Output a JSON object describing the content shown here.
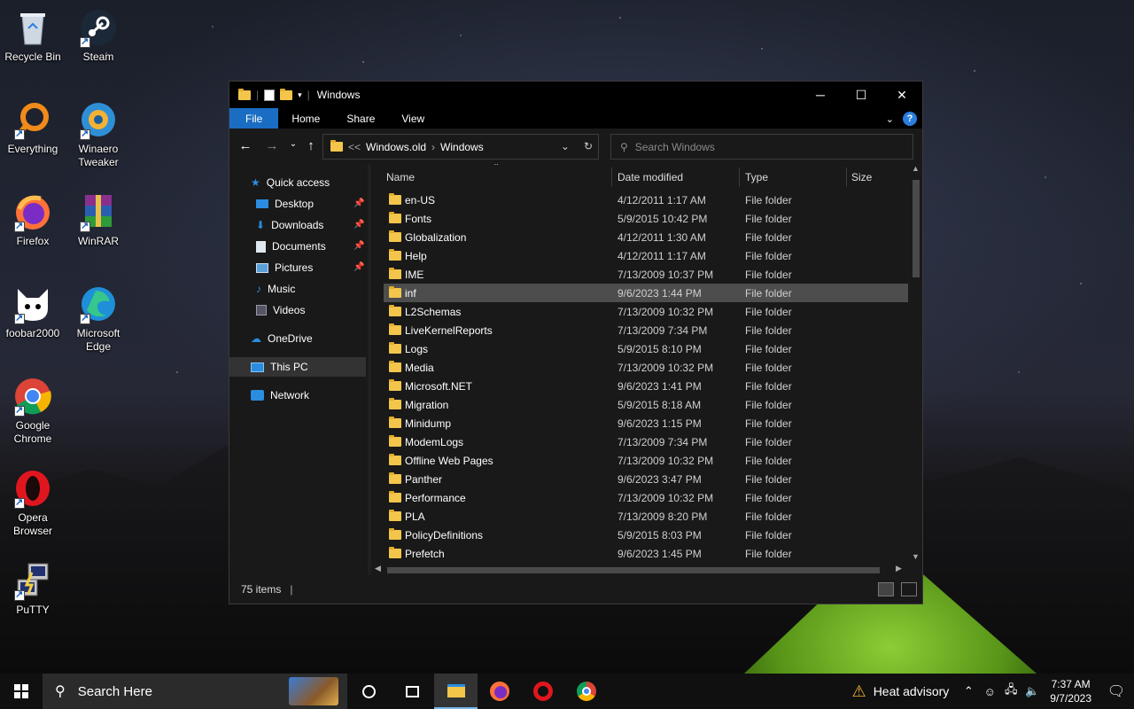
{
  "desktop": {
    "icons": [
      {
        "label": "Recycle Bin",
        "icon": "recycle-bin-icon"
      },
      {
        "label": "Steam",
        "icon": "steam-icon"
      },
      {
        "label": "Everything",
        "icon": "everything-icon"
      },
      {
        "label": "Winaero Tweaker",
        "icon": "winaero-tweaker-icon"
      },
      {
        "label": "Firefox",
        "icon": "firefox-icon"
      },
      {
        "label": "WinRAR",
        "icon": "winrar-icon"
      },
      {
        "label": "foobar2000",
        "icon": "foobar2000-icon"
      },
      {
        "label": "Microsoft Edge",
        "icon": "edge-icon"
      },
      {
        "label": "Google Chrome",
        "icon": "chrome-icon"
      },
      {
        "label": "Opera Browser",
        "icon": "opera-icon"
      },
      {
        "label": "PuTTY",
        "icon": "putty-icon"
      }
    ]
  },
  "explorer": {
    "title": "Windows",
    "ribbon": {
      "file": "File",
      "home": "Home",
      "share": "Share",
      "view": "View",
      "help": "?"
    },
    "address": {
      "overflow": "<<",
      "crumb1": "Windows.old",
      "crumb2": "Windows"
    },
    "search": {
      "placeholder": "Search Windows"
    },
    "nav": {
      "quick_access": "Quick access",
      "desktop": "Desktop",
      "downloads": "Downloads",
      "documents": "Documents",
      "pictures": "Pictures",
      "music": "Music",
      "videos": "Videos",
      "onedrive": "OneDrive",
      "this_pc": "This PC",
      "network": "Network"
    },
    "columns": {
      "name": "Name",
      "date": "Date modified",
      "type": "Type",
      "size": "Size"
    },
    "files": [
      {
        "name": "en-US",
        "date": "4/12/2011 1:17 AM",
        "type": "File folder"
      },
      {
        "name": "Fonts",
        "date": "5/9/2015 10:42 PM",
        "type": "File folder"
      },
      {
        "name": "Globalization",
        "date": "4/12/2011 1:30 AM",
        "type": "File folder"
      },
      {
        "name": "Help",
        "date": "4/12/2011 1:17 AM",
        "type": "File folder"
      },
      {
        "name": "IME",
        "date": "7/13/2009 10:37 PM",
        "type": "File folder"
      },
      {
        "name": "inf",
        "date": "9/6/2023 1:44 PM",
        "type": "File folder"
      },
      {
        "name": "L2Schemas",
        "date": "7/13/2009 10:32 PM",
        "type": "File folder"
      },
      {
        "name": "LiveKernelReports",
        "date": "7/13/2009 7:34 PM",
        "type": "File folder"
      },
      {
        "name": "Logs",
        "date": "5/9/2015 8:10 PM",
        "type": "File folder"
      },
      {
        "name": "Media",
        "date": "7/13/2009 10:32 PM",
        "type": "File folder"
      },
      {
        "name": "Microsoft.NET",
        "date": "9/6/2023 1:41 PM",
        "type": "File folder"
      },
      {
        "name": "Migration",
        "date": "5/9/2015 8:18 AM",
        "type": "File folder"
      },
      {
        "name": "Minidump",
        "date": "9/6/2023 1:15 PM",
        "type": "File folder"
      },
      {
        "name": "ModemLogs",
        "date": "7/13/2009 7:34 PM",
        "type": "File folder"
      },
      {
        "name": "Offline Web Pages",
        "date": "7/13/2009 10:32 PM",
        "type": "File folder"
      },
      {
        "name": "Panther",
        "date": "9/6/2023 3:47 PM",
        "type": "File folder"
      },
      {
        "name": "Performance",
        "date": "7/13/2009 10:32 PM",
        "type": "File folder"
      },
      {
        "name": "PLA",
        "date": "7/13/2009 8:20 PM",
        "type": "File folder"
      },
      {
        "name": "PolicyDefinitions",
        "date": "5/9/2015 8:03 PM",
        "type": "File folder"
      },
      {
        "name": "Prefetch",
        "date": "9/6/2023 1:45 PM",
        "type": "File folder"
      }
    ],
    "hovered_row": "inf",
    "status": "75 items"
  },
  "taskbar": {
    "search_placeholder": "Search Here",
    "weather": "Heat advisory",
    "time": "7:37 AM",
    "date": "9/7/2023",
    "accent": "#76b9ed"
  },
  "colors": {
    "file_tab": "#1a6dc2",
    "folder": "#f3c64b"
  }
}
